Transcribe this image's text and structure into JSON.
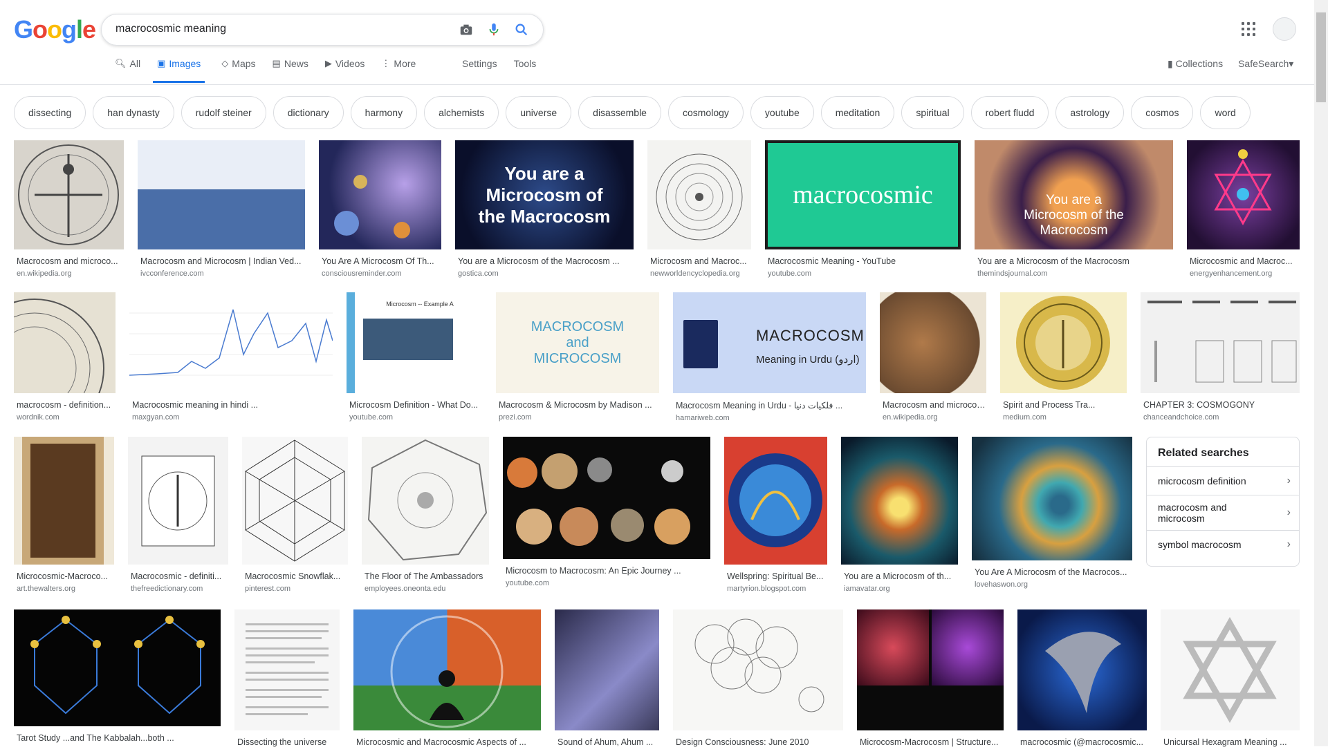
{
  "header": {
    "logo": "Google",
    "query": "macrocosmic meaning",
    "tabs": [
      {
        "label": "All",
        "icon": "search-icon"
      },
      {
        "label": "Images",
        "icon": "image-icon"
      },
      {
        "label": "Maps",
        "icon": "map-icon"
      },
      {
        "label": "News",
        "icon": "news-icon"
      },
      {
        "label": "Videos",
        "icon": "video-icon"
      },
      {
        "label": "More",
        "icon": "more-vert-icon"
      }
    ],
    "settings": "Settings",
    "tools": "Tools",
    "collections": "Collections",
    "safesearch": "SafeSearch"
  },
  "chips": [
    "dissecting",
    "han dynasty",
    "rudolf steiner",
    "dictionary",
    "harmony",
    "alchemists",
    "universe",
    "disassemble",
    "cosmology",
    "youtube",
    "meditation",
    "spiritual",
    "robert fludd",
    "astrology",
    "cosmos",
    "word"
  ],
  "results": [
    {
      "title": "Macrocosm and microco...",
      "source": "en.wikipedia.org"
    },
    {
      "title": "Macrocosm and Microcosm | Indian Ved...",
      "source": "ivcconference.com"
    },
    {
      "title": "You Are A Microcosm Of Th...",
      "source": "consciousreminder.com"
    },
    {
      "title": "You are a Microcosm of the Macrocosm ...",
      "source": "gostica.com",
      "overlay": "You are a Microcosm of the Macrocosm"
    },
    {
      "title": "Microcosm and Macroc...",
      "source": "newworldencyclopedia.org"
    },
    {
      "title": "Macrocosmic Meaning - YouTube",
      "source": "youtube.com",
      "overlay": "macrocosmic"
    },
    {
      "title": "You are a Microcosm of the Macrocosm",
      "source": "themindsjournal.com",
      "overlay": "You are a Microcosm of the Macrocosm"
    },
    {
      "title": "Microcosmic and Macroc...",
      "source": "energyenhancement.org"
    },
    {
      "title": "macrocosm - definition...",
      "source": "wordnik.com"
    },
    {
      "title": "Macrocosmic meaning in hindi ...",
      "source": "maxgyan.com"
    },
    {
      "title": "Microcosm Definition - What Do...",
      "source": "youtube.com",
      "overlay": "Microcosm -- Example A"
    },
    {
      "title": "Macrocosm & Microcosm by Madison ...",
      "source": "prezi.com",
      "overlay": "MACROCOSM and MICROCOSM"
    },
    {
      "title": "Macrocosm Meaning in Urdu - فلکیات دنیا ...",
      "source": "hamariweb.com",
      "overlay": "MACROCOSM",
      "overlay2": "Meaning in Urdu (اردو)"
    },
    {
      "title": "Macrocosm and microcosm - ...",
      "source": "en.wikipedia.org"
    },
    {
      "title": "Spirit and Process Tra...",
      "source": "medium.com"
    },
    {
      "title": "CHAPTER 3: COSMOGONY",
      "source": "chanceandchoice.com"
    },
    {
      "title": "Microcosmic-Macroco...",
      "source": "art.thewalters.org"
    },
    {
      "title": "Macrocosmic - definiti...",
      "source": "thefreedictionary.com"
    },
    {
      "title": "Macrocosmic Snowflak...",
      "source": "pinterest.com"
    },
    {
      "title": "The Floor of The Ambassadors",
      "source": "employees.oneonta.edu"
    },
    {
      "title": "Microcosm to Macrocosm: An Epic Journey ...",
      "source": "youtube.com"
    },
    {
      "title": "Wellspring: Spiritual Be...",
      "source": "martyrion.blogspot.com"
    },
    {
      "title": "You are a Microcosm of th...",
      "source": "iamavatar.org"
    },
    {
      "title": "You Are A Microcosm of the Macrocos...",
      "source": "lovehaswon.org"
    },
    {
      "title": "Tarot Study ...and The Kabbalah...both ...",
      "source": ""
    },
    {
      "title": "Dissecting the universe",
      "source": ""
    },
    {
      "title": "Microcosmic and Macrocosmic Aspects of ...",
      "source": ""
    },
    {
      "title": "Sound of Ahum, Ahum ...",
      "source": ""
    },
    {
      "title": "Design Consciousness: June 2010",
      "source": ""
    },
    {
      "title": "Microcosm-Macrocosm | Structure...",
      "source": ""
    },
    {
      "title": "macrocosmic (@macrocosmic...",
      "source": ""
    },
    {
      "title": "Unicursal Hexagram Meaning ...",
      "source": ""
    }
  ],
  "related": {
    "heading": "Related searches",
    "items": [
      "microcosm definition",
      "macrocosm and microcosm",
      "symbol macrocosm"
    ]
  }
}
